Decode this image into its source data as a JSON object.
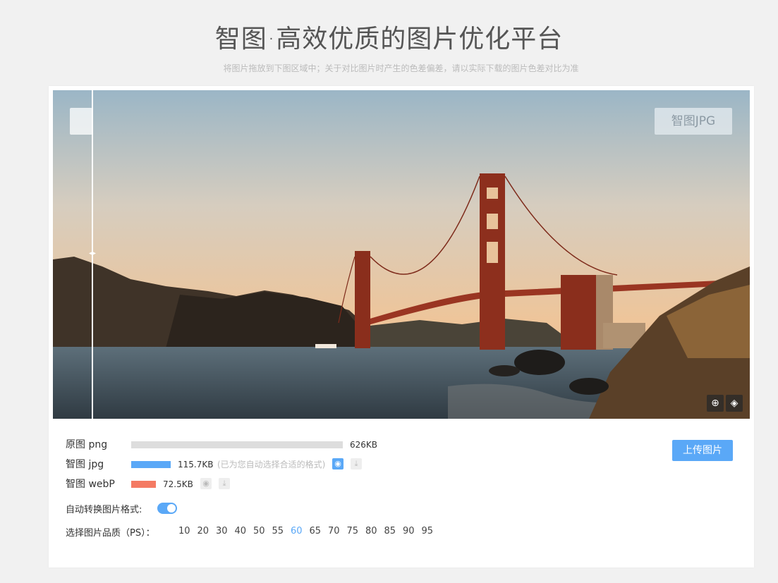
{
  "header": {
    "title": "智图·高效优质的图片优化平台",
    "subtitle": "将图片拖放到下图区域中；关于对比图片时产生的色差偏差，请以实际下载的图片色差对比为准"
  },
  "preview": {
    "compare_badge": "智图JPG",
    "zoom_icon": "magnifier-plus-icon",
    "paint_icon": "paint-bucket-icon"
  },
  "results": {
    "original": {
      "label": "原图 png",
      "size": "626KB",
      "bar_color": "#dddddd",
      "ratio": 1.0
    },
    "jpg": {
      "label": "智图 jpg",
      "size": "115.7KB",
      "hint": "(已为您自动选择合适的格式)",
      "bar_color": "#5aa8f7",
      "ratio": 0.185
    },
    "webp": {
      "label": "智图 webP",
      "size": "72.5KB",
      "bar_color": "#f47a63",
      "ratio": 0.116
    }
  },
  "upload_label": "上传图片",
  "auto_convert": {
    "label": "自动转换图片格式:",
    "on": true
  },
  "quality": {
    "label": "选择图片品质（PS）：",
    "options": [
      "10",
      "20",
      "30",
      "40",
      "50",
      "55",
      "60",
      "65",
      "70",
      "75",
      "80",
      "85",
      "90",
      "95"
    ],
    "selected": "60"
  },
  "colors": {
    "accent": "#5aa8f7",
    "webp": "#f47a63"
  }
}
